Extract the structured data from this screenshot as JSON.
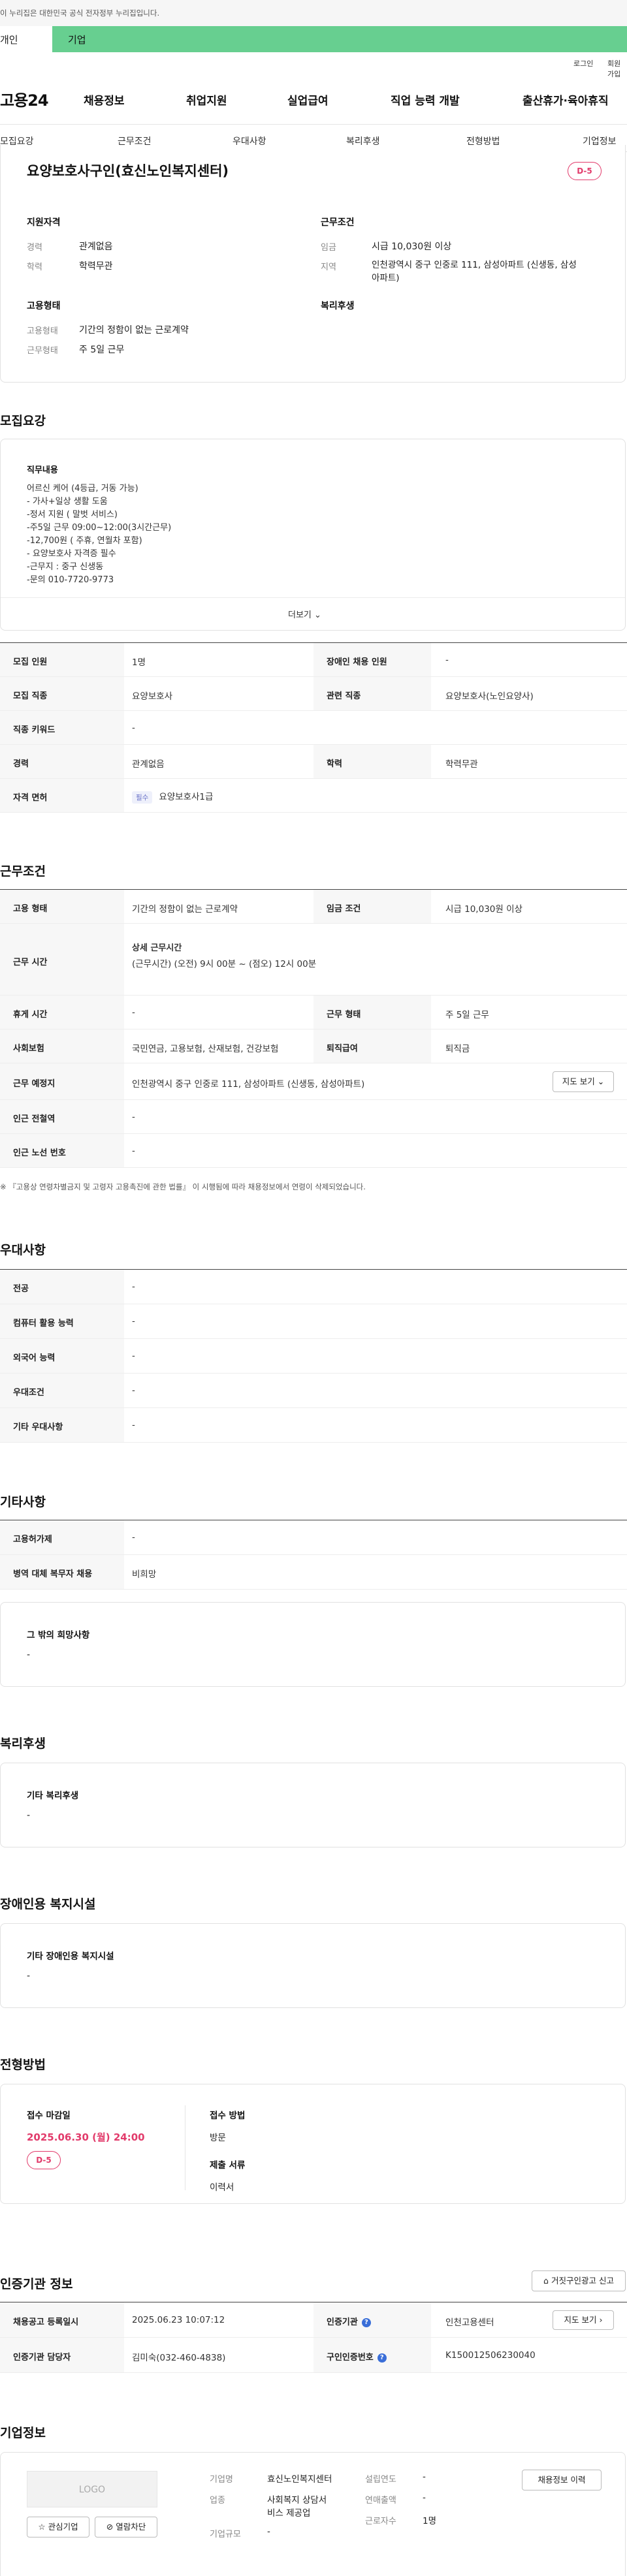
{
  "gov_banner": {
    "text": "이 누리집은 대한민국 공식 전자정부 누리집입니다."
  },
  "top_tabs": {
    "personal": "개인",
    "company": "기업"
  },
  "util": {
    "login": "로그인",
    "signup": "회원가입"
  },
  "header": {
    "logo": "고용24",
    "nav": [
      "채용정보",
      "취업지원",
      "실업급여",
      "직업 능력 개발",
      "출산휴가·육아휴직"
    ]
  },
  "anchors": [
    "모집요강",
    "근무조건",
    "우대사항",
    "복리후생",
    "전형방법",
    "기업정보"
  ],
  "summary": {
    "title": "요양보호사구인(효신노인복지센터)",
    "dday": "D-5",
    "qual_head": "지원자격",
    "career_label": "경력",
    "career_value": "관계없음",
    "edu_label": "학력",
    "edu_value": "학력무관",
    "work_head": "근무조건",
    "wage_label": "임금",
    "wage_value": "시급 10,030원 이상",
    "region_label": "지역",
    "region_value_1": "인천광역시 중구 인중로 111, 삼성아파트 (신생동, 삼성",
    "region_value_2": "아파트)",
    "emp_head": "고용형태",
    "emp_label": "고용형태",
    "emp_value": "기간의 정함이 없는 근로계약",
    "hours_label": "근무형태",
    "hours_value": "주 5일 근무",
    "welfare_head": "복리후생"
  },
  "recruit": {
    "section_title": "모집요강",
    "duty_head": "직무내용",
    "duty_lines": [
      "어르신 케어 (4등급, 거동 가능)",
      "- 가사+일상 생활 도움",
      "-정서 지원 ( 말벗 서비스)",
      "-주5일 근무 09:00~12:00(3시간근무)",
      "-12,700원 ( 주휴, 연월차 포함)",
      "- 요양보호사 자격증 필수",
      "-근무지 : 중구 신생동",
      "-문의 010-7720-9773"
    ],
    "more": "더보기",
    "rows": [
      {
        "h1": "모집 인원",
        "v1": "1명",
        "h2": "장애인 채용 인원",
        "v2": "-"
      },
      {
        "h1": "모집 직종",
        "v1": "요양보호사",
        "h2": "관련 직종",
        "v2": "요양보호사(노인요양사)"
      },
      {
        "h1": "직종 키워드",
        "v1": "-"
      },
      {
        "h1": "경력",
        "v1": "관계없음",
        "h2": "학력",
        "v2": "학력무관"
      },
      {
        "h1": "자격 면허",
        "chip": "필수",
        "v1": "요양보호사1급"
      }
    ]
  },
  "work": {
    "section_title": "근무조건",
    "emp_type_h": "고용 형태",
    "emp_type_v": "기간의 정함이 없는 근로계약",
    "wage_h": "임금 조건",
    "wage_v": "시급 10,030원 이상",
    "time_h": "근무 시간",
    "time_sub": "상세 근무시간",
    "time_v": "(근무시간) (오전) 9시 00분 ~ (점오) 12시 00분",
    "rest_h": "휴게 시간",
    "rest_v": "-",
    "form_h": "근무 형태",
    "form_v": "주 5일 근무",
    "ins_h": "사회보험",
    "ins_v": "국민연금, 고용보험, 산재보험, 건강보험",
    "sev_h": "퇴직급여",
    "sev_v": "퇴직금",
    "place_h": "근무 예정지",
    "place_v": "인천광역시 중구 인중로 111, 삼성아파트 (신생동, 삼성아파트)",
    "map_btn": "지도 보기",
    "station_h": "인근 전철역",
    "station_v": "-",
    "bus_h": "인근 노선 번호",
    "bus_v": "-",
    "note": "※ 『고용상 연령차별금지 및 고령자 고용촉진에 관한 법률』 이 시행됨에 따라 채용정보에서 연령이 삭제되었습니다."
  },
  "pref": {
    "section_title": "우대사항",
    "rows": [
      {
        "h": "전공",
        "v": "-"
      },
      {
        "h": "컴퓨터 활용 능력",
        "v": "-"
      },
      {
        "h": "외국어 능력",
        "v": "-"
      },
      {
        "h": "우대조건",
        "v": "-"
      },
      {
        "h": "기타 우대사항",
        "v": "-"
      }
    ]
  },
  "etc": {
    "section_title": "기타사항",
    "rows": [
      {
        "h": "고용허가제",
        "v": "-"
      },
      {
        "h": "병역 대체 복무자 채용",
        "v": "비희망"
      }
    ],
    "hope_head": "그 밖의 희망사항",
    "hope_val": "-"
  },
  "welfare": {
    "section_title": "복리후생",
    "head": "기타 복리후생",
    "val": "-"
  },
  "disabled": {
    "section_title": "장애인용 복지시설",
    "head": "기타 장애인용 복지시설",
    "val": "-"
  },
  "process": {
    "section_title": "전형방법",
    "deadline_h": "접수 마감일",
    "deadline_v": "2025.06.30 (월) 24:00",
    "dday": "D-5",
    "method_h": "접수 방법",
    "method_v": "방문",
    "docs_h": "제출 서류",
    "docs_v": "이력서"
  },
  "cert": {
    "section_title": "인증기관 정보",
    "report_btn": "거짓구인광고 신고",
    "reg_h": "채용공고 등록일시",
    "reg_v": "2025.06.23 10:07:12",
    "org_h": "인증기관",
    "org_v": "인천고용센터",
    "map_btn": "지도 보기",
    "mgr_h": "인증기관 담당자",
    "mgr_v": "김미숙(032-460-4838)",
    "no_h": "구인인증번호",
    "no_v": "K150012506230040"
  },
  "company": {
    "section_title": "기업정보",
    "logo_text": "LOGO",
    "fav_btn": "관심기업",
    "block_btn": "열람차단",
    "name_h": "기업명",
    "name_v": "효신노인복지센터",
    "ind_h": "업종",
    "ind_v_1": "사회복지 상담서",
    "ind_v_2": "비스 제공업",
    "size_h": "기업규모",
    "size_v": "-",
    "year_h": "설립연도",
    "year_v": "-",
    "sales_h": "연매출액",
    "sales_v": "-",
    "staff_h": "근로자수",
    "staff_v": "1명",
    "history_btn": "채용정보 이력"
  }
}
